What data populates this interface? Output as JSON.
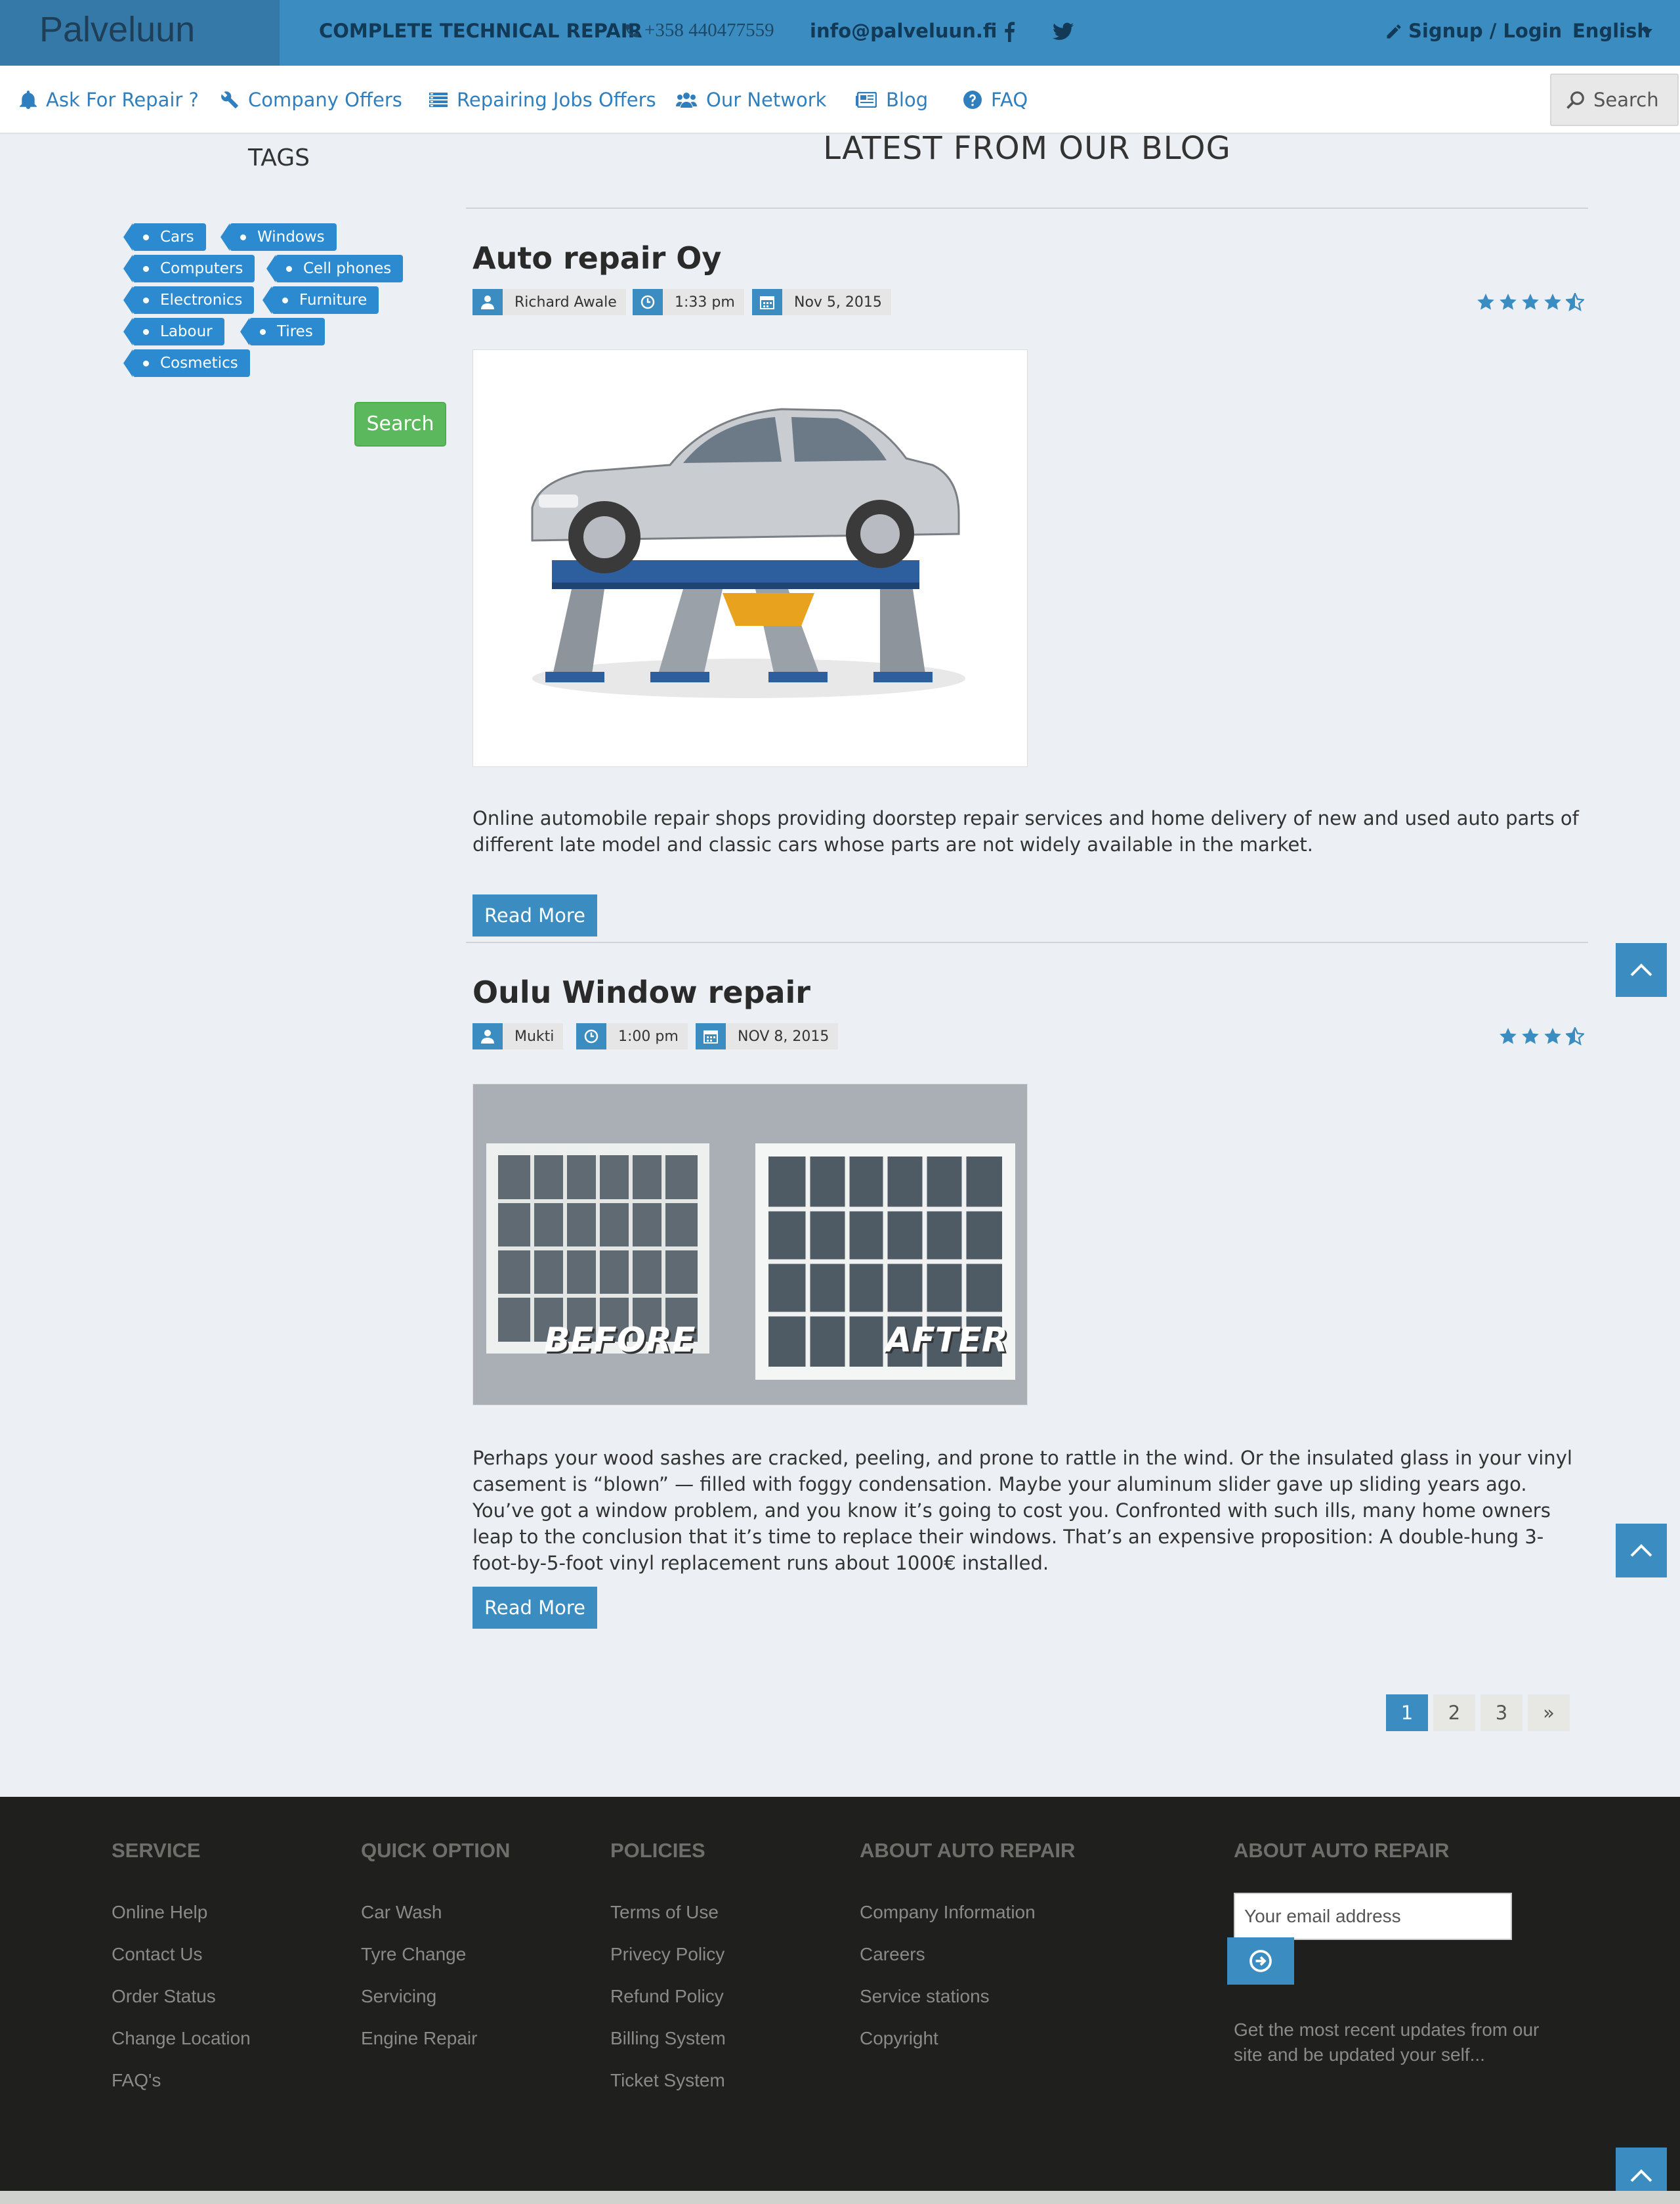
{
  "header": {
    "brand": "Palveluun",
    "tagline": "COMPLETE TECHNICAL REPAIR",
    "phone": "+358 440477559",
    "email": "info@palveluun.fi",
    "signup_label": "Signup / Login",
    "language": "English"
  },
  "nav": {
    "items": [
      {
        "label": "Ask For Repair ?",
        "icon": "bell-icon"
      },
      {
        "label": "Company Offers",
        "icon": "wrench-icon"
      },
      {
        "label": "Repairing Jobs Offers",
        "icon": "list-icon"
      },
      {
        "label": "Our Network",
        "icon": "users-icon"
      },
      {
        "label": "Blog",
        "icon": "newspaper-icon"
      },
      {
        "label": "FAQ",
        "icon": "question-icon"
      }
    ],
    "search_label": "Search"
  },
  "sidebar": {
    "title": "TAGS",
    "tags": [
      "Cars",
      "Windows",
      "Computers",
      "Cell phones",
      "Electronics",
      "Furniture",
      "Labour",
      "Tires",
      "Cosmetics"
    ],
    "search_label": "Search"
  },
  "blog": {
    "heading": "LATEST FROM OUR BLOG",
    "posts": [
      {
        "title": "Auto repair Oy",
        "author": "Richard Awale",
        "time": "1:33 pm",
        "date": "Nov 5, 2015",
        "rating": 4.5,
        "text": "Online automobile repair shops providing doorstep repair services and home delivery of new and used auto parts of different late model and classic cars whose parts are not widely available in the market.",
        "read_more": "Read More"
      },
      {
        "title": "Oulu Window repair",
        "author": "Mukti",
        "time": "1:00 pm",
        "date": "NOV 8, 2015",
        "rating": 3.5,
        "image_labels": [
          "BEFORE",
          "AFTER"
        ],
        "text": "Perhaps your wood sashes are cracked, peeling, and prone to rattle in the wind. Or the insulated glass in your vinyl casement is “blown” — filled with foggy condensation. Maybe your aluminum slider gave up sliding years ago. You’ve got a window problem, and you know it’s going to cost you. Confronted with such ills, many home owners leap to the conclusion that it’s time to replace their windows. That’s an expensive proposition: A double-hung 3-foot-by-5-foot vinyl replacement runs about 1000€ installed.",
        "read_more": "Read More"
      }
    ],
    "pagination": [
      "1",
      "2",
      "3",
      "»"
    ],
    "current_page": "1"
  },
  "footer": {
    "columns": [
      {
        "heading": "SERVICE",
        "links": [
          "Online Help",
          "Contact Us",
          "Order Status",
          "Change Location",
          "FAQ's"
        ]
      },
      {
        "heading": "QUICK OPTION",
        "links": [
          "Car Wash",
          "Tyre Change",
          "Servicing",
          "Engine Repair"
        ]
      },
      {
        "heading": "POLICIES",
        "links": [
          "Terms of Use",
          "Privecy Policy",
          "Refund Policy",
          "Billing System",
          "Ticket System"
        ]
      },
      {
        "heading": "ABOUT AUTO REPAIR",
        "links": [
          "Company Information",
          "Careers",
          "Service stations",
          "Copyright"
        ]
      }
    ],
    "newsletter": {
      "heading": "ABOUT AUTO REPAIR",
      "placeholder": "Your email address",
      "note": "Get the most recent updates from our site and be updated your self..."
    }
  },
  "colors": {
    "primary": "#3a8cc1",
    "brand_bg": "#3579a8",
    "tag": "#2c8bd0",
    "search_green": "#5cb85c",
    "footer_bg": "#1f1f1d"
  }
}
